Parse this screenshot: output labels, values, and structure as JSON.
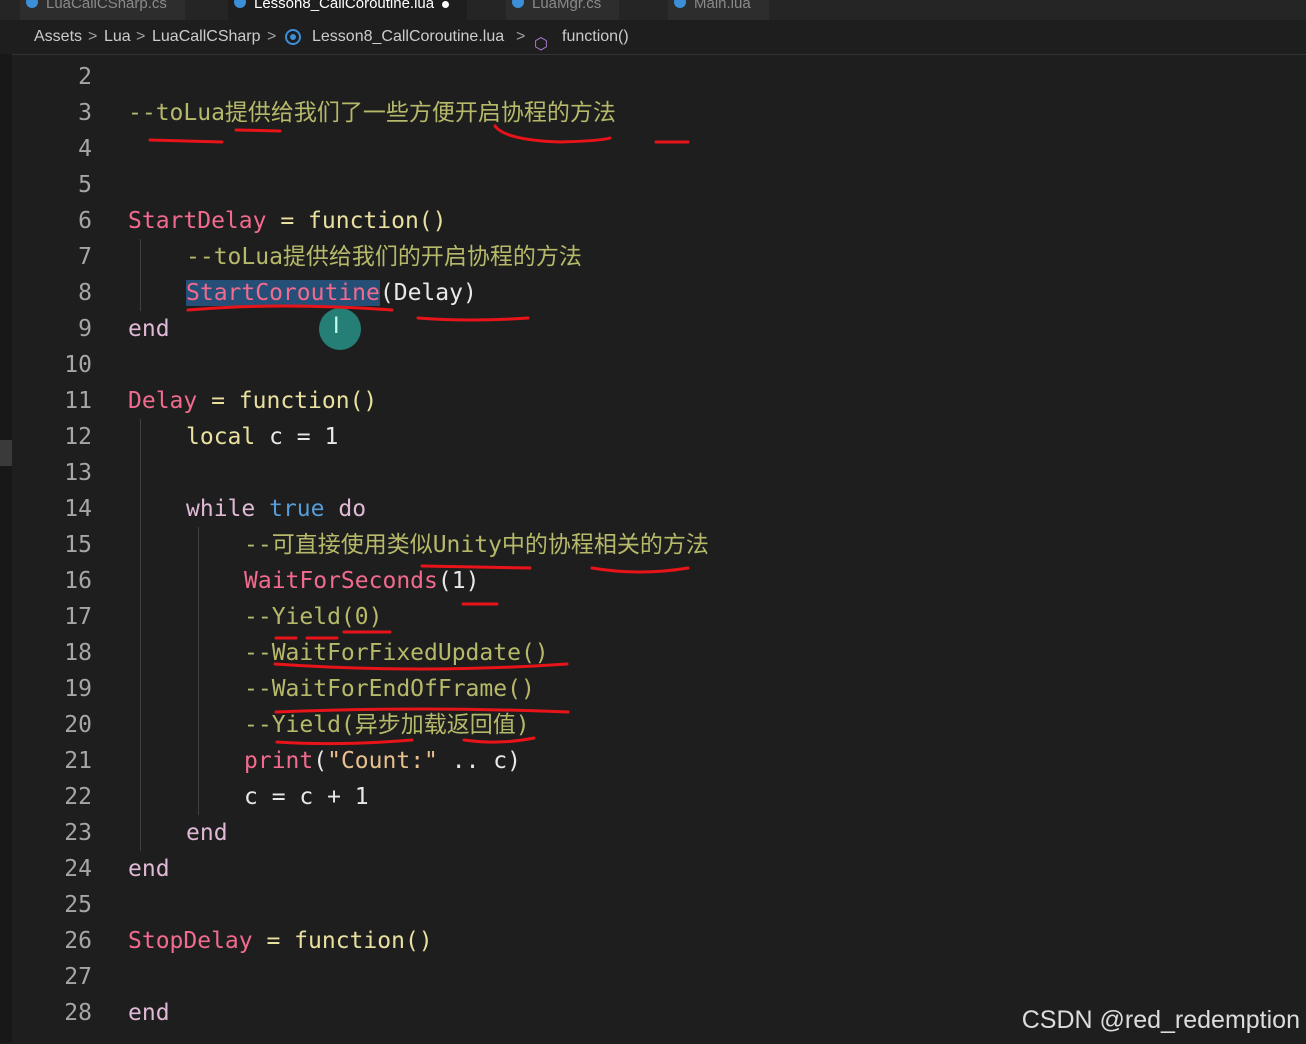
{
  "tabs": [
    {
      "label": "LuaCallCSharp.cs",
      "active": false
    },
    {
      "label": "Lesson8_CallCoroutine.lua",
      "active": true,
      "modified": true
    },
    {
      "label": "LuaMgr.cs",
      "active": false
    },
    {
      "label": "Main.lua",
      "active": false
    }
  ],
  "breadcrumb": {
    "items": [
      "Assets",
      "Lua",
      "LuaCallCSharp",
      "Lesson8_CallCoroutine.lua",
      "function()"
    ],
    "separator": ">"
  },
  "editor": {
    "line_numbers": [
      "2",
      "3",
      "4",
      "5",
      "6",
      "7",
      "8",
      "9",
      "10",
      "11",
      "12",
      "13",
      "14",
      "15",
      "16",
      "17",
      "18",
      "19",
      "20",
      "21",
      "22",
      "23",
      "24",
      "25",
      "26",
      "27",
      "28"
    ],
    "lines": {
      "l3_comment": "--toLua提供给我们了一些方便开启协程的方法",
      "l6_name": "StartDelay",
      "l6_rest": " = function()",
      "l7_comment": "--toLua提供给我们的开启协程的方法",
      "l8_call": "StartCoroutine",
      "l8_arg": "(Delay)",
      "l9_end": "end",
      "l11_name": "Delay",
      "l11_rest": " = function()",
      "l12_local": "local",
      "l12_rest": " c = 1",
      "l14_while": "while",
      "l14_true": "true",
      "l14_do": "do",
      "l15_comment": "--可直接使用类似Unity中的协程相关的方法",
      "l16_call": "WaitForSeconds",
      "l16_arg": "(1)",
      "l17_comment": "--Yield(0)",
      "l18_comment": "--WaitForFixedUpdate()",
      "l19_comment": "--WaitForEndOfFrame()",
      "l20_comment": "--Yield(异步加载返回值)",
      "l21_print": "print",
      "l21_open": "(",
      "l21_str": "\"Count:\"",
      "l21_rest": " .. c)",
      "l22_code": "c = c + 1",
      "l23_end": "end",
      "l24_end": "end",
      "l26_name": "StopDelay",
      "l26_rest": " = function()",
      "l28_end": "end"
    }
  },
  "watermark": "CSDN @red_redemption",
  "colors": {
    "background": "#1e1e1e",
    "identifier": "#f26b8e",
    "comment": "#6a9955",
    "annotation_ink": "#e8141a",
    "selection": "#264f78"
  }
}
